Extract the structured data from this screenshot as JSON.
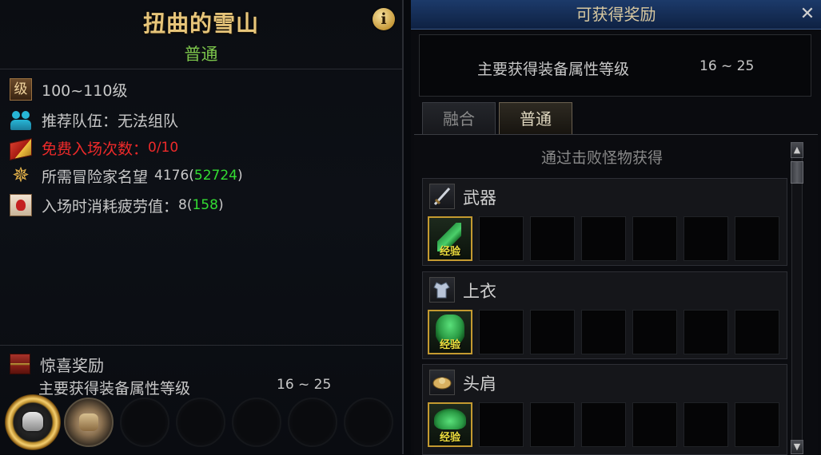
{
  "dungeon": {
    "title": "扭曲的雪山",
    "difficulty": "普通",
    "info_icon": "i"
  },
  "info": {
    "level": {
      "icon": "级",
      "text": "100~110级"
    },
    "party": {
      "label": "推荐队伍：无法组队"
    },
    "free_entry": {
      "label": "免费入场次数：",
      "value": "0/10"
    },
    "fame": {
      "label": "所需冒险家名望",
      "value": "4176",
      "bonus": "52724"
    },
    "fatigue": {
      "label": "入场时消耗疲劳值：",
      "value": "8",
      "remaining": "158"
    }
  },
  "surprise_reward": {
    "title": "惊喜奖励",
    "subtitle": "主要获得装备属性等级",
    "range": "16 ~ 25"
  },
  "reward_panel": {
    "title": "可获得奖励",
    "close_icon": "✕",
    "summary_label": "主要获得装备属性等级",
    "summary_range": "16 ~ 25",
    "tabs": [
      {
        "label": "融合",
        "active": false
      },
      {
        "label": "普通",
        "active": true
      }
    ],
    "section_header": "通过击败怪物获得",
    "categories": [
      {
        "label": "武器",
        "icon": "sword-icon",
        "items": [
          {
            "tag": "经验",
            "icon": "weapon-item-icon"
          }
        ]
      },
      {
        "label": "上衣",
        "icon": "top-armor-icon",
        "items": [
          {
            "tag": "经验",
            "icon": "top-item-icon"
          }
        ]
      },
      {
        "label": "头肩",
        "icon": "shoulder-armor-icon",
        "items": [
          {
            "tag": "经验",
            "icon": "shoulder-item-icon"
          }
        ]
      }
    ]
  },
  "colors": {
    "title_gold": "#e7c57a",
    "difficulty_green": "#7cc54b",
    "highlight_green": "#33dd33",
    "warning_red": "#ee2a2a",
    "titlebar_blue": "#1c3a6a"
  }
}
